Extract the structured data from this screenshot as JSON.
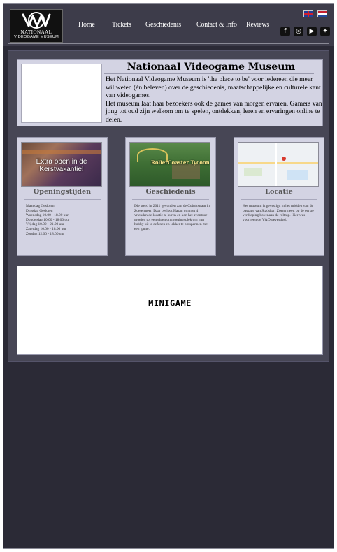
{
  "logo": {
    "line1": "NATIONAAL",
    "line2": "VIDEOGAME MUSEUM"
  },
  "nav": [
    "Home",
    "Tickets",
    "Geschiedenis",
    "Contact & Info",
    "Reviews"
  ],
  "flags": [
    "english-flag-icon",
    "dutch-flag-icon"
  ],
  "social": [
    {
      "icon": "facebook-icon",
      "glyph": "f"
    },
    {
      "icon": "instagram-icon",
      "glyph": "◎"
    },
    {
      "icon": "youtube-icon",
      "glyph": "▶"
    },
    {
      "icon": "twitter-icon",
      "glyph": "✦"
    }
  ],
  "intro": {
    "title": "Nationaal Videogame Museum",
    "paragraph1": "Het Nationaal Videogame Museum is 'the place to be' voor iedereen die meer wil weten (én beleven) over de geschiedenis, maatschappelijke en culturele kant van videogames.",
    "paragraph2": "Het museum laat haar bezoekers ook de games van morgen ervaren. Gamers van jong tot oud zijn welkom om te spelen, ontdekken, leren en ervaringen online te delen."
  },
  "cards": [
    {
      "title": "Openingstijden",
      "image_text": "Extra open in de Kerstvakantie!",
      "lines": [
        "Maandag Gesloten",
        "Dinsdag Gesloten",
        "Woensdag 10.00 - 18.00 uur",
        "Donderdag 10.00 - 18.00 uur",
        "Vrijdag 10.00 - 21.00 uur",
        "Zaterdag 10.00 - 18.00 uur",
        "Zondag 12.00 - 18.00 uur"
      ]
    },
    {
      "title": "Geschiedenis",
      "image_text": "RollerCoaster Tycoon",
      "lines": [
        "Die werd in 2011 gevonden aan de Cobaltstraat in Zoetermeer. Daar besloot Hasan om met 4 vrienden de locatie te huren en kon het avontuur groeien tot een eigen ontmoetingsplek om hun hobby uit te oefenen en lekker te ontspannen met een game."
      ]
    },
    {
      "title": "Locatie",
      "image_text": "",
      "lines": [
        "Het museum is gevestigd in het midden van de passage van Stadshart Zoetermeer, op de eerste verdieping bovenaan de roltrap. Hier was voorheen de V&D gevestigd."
      ]
    }
  ],
  "minigame": {
    "title": "MINIGAME"
  },
  "colors": {
    "header": "#3d3c4a",
    "panel": "#d3d3e3",
    "page": "#2b2a36"
  }
}
